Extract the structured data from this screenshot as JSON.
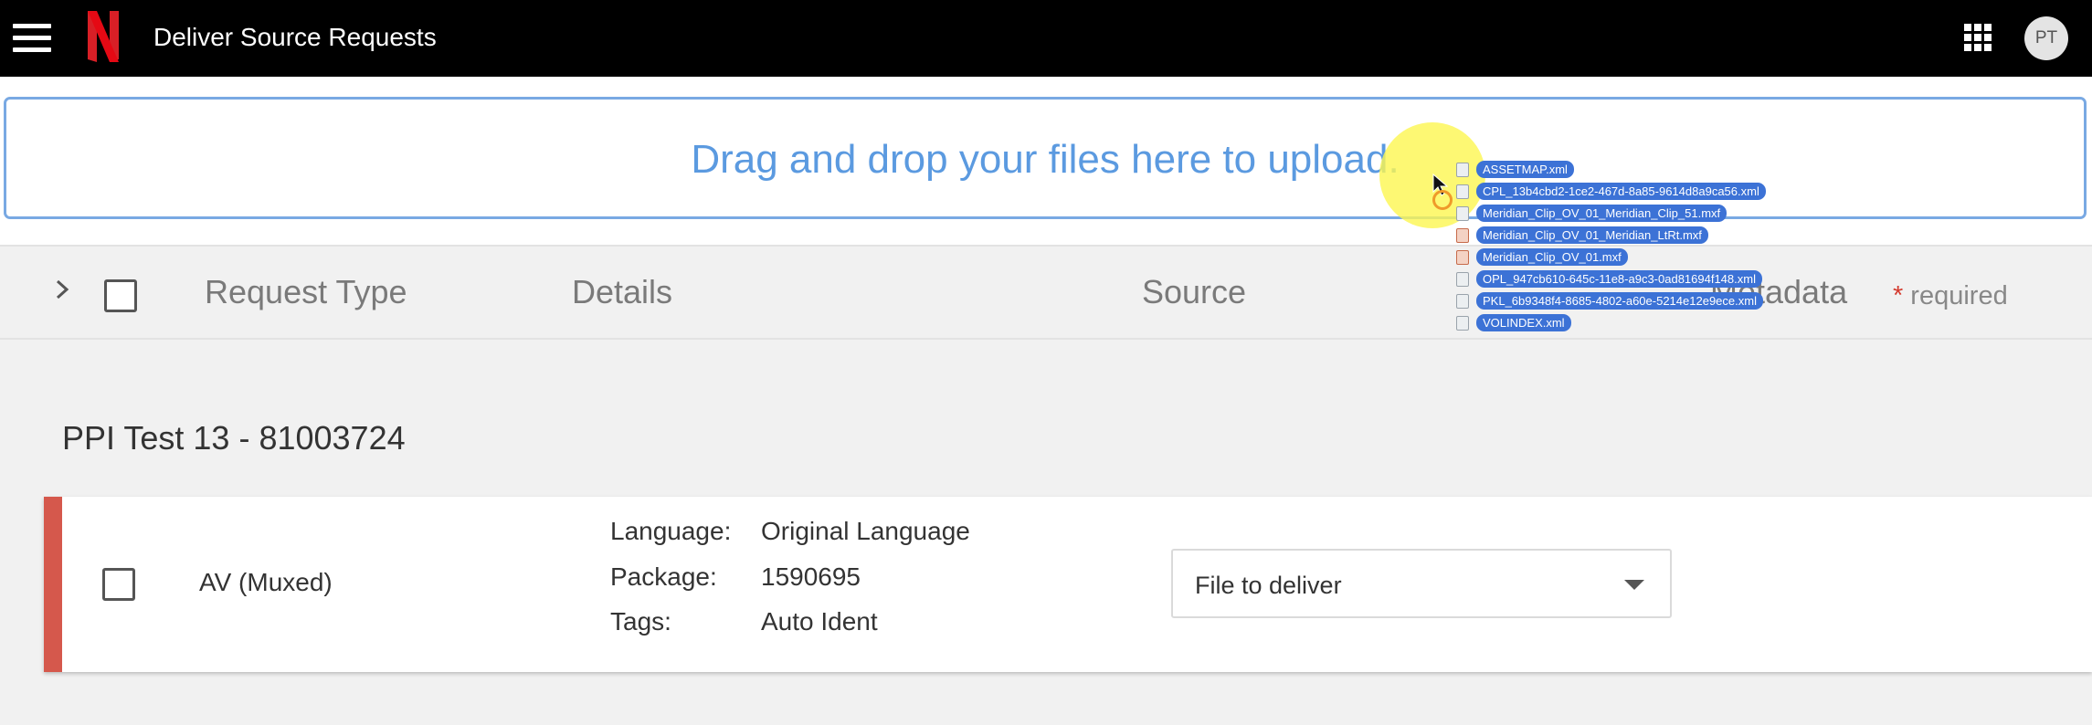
{
  "header": {
    "title": "Deliver Source Requests",
    "avatar_initials": "PT",
    "logo_icon": "netflix-n-logo",
    "menu_icon": "hamburger-menu-icon",
    "apps_icon": "apps-grid-icon"
  },
  "upload": {
    "dropzone_text": "Drag and drop your files here to upload."
  },
  "dragged_files": [
    {
      "name": "ASSETMAP.xml",
      "icon": "xml-file-icon"
    },
    {
      "name": "CPL_13b4cbd2-1ce2-467d-8a85-9614d8a9ca56.xml",
      "icon": "xml-file-icon"
    },
    {
      "name": "Meridian_Clip_OV_01_Meridian_Clip_51.mxf",
      "icon": "xml-file-icon"
    },
    {
      "name": "Meridian_Clip_OV_01_Meridian_LtRt.mxf",
      "icon": "media-file-icon"
    },
    {
      "name": "Meridian_Clip_OV_01.mxf",
      "icon": "media-file-icon"
    },
    {
      "name": "OPL_947cb610-645c-11e8-a9c3-0ad81694f148.xml",
      "icon": "xml-file-icon"
    },
    {
      "name": "PKL_6b9348f4-8685-4802-a60e-5214e12e9ece.xml",
      "icon": "xml-file-icon"
    },
    {
      "name": "VOLINDEX.xml",
      "icon": "xml-file-icon"
    }
  ],
  "table_header": {
    "columns": [
      "Request Type",
      "Details",
      "Source",
      "Metadata"
    ],
    "required_star": "*",
    "required_label": "required"
  },
  "package": {
    "title": "PPI Test 13 - 81003724"
  },
  "request": {
    "type": "AV (Muxed)",
    "details": [
      {
        "label": "Language:",
        "value": "Original Language"
      },
      {
        "label": "Package:",
        "value": "1590695"
      },
      {
        "label": "Tags:",
        "value": "Auto Ident"
      }
    ],
    "source_select": "File to deliver"
  },
  "colors": {
    "topbar": "#000000",
    "dropzone_border": "#79a9e3",
    "dropzone_text": "#5b9ae0",
    "status_bar": "#d5584c",
    "required_star": "#d43b2f",
    "drag_chip": "#3c72d6",
    "cursor_highlight": "#fcf650"
  }
}
